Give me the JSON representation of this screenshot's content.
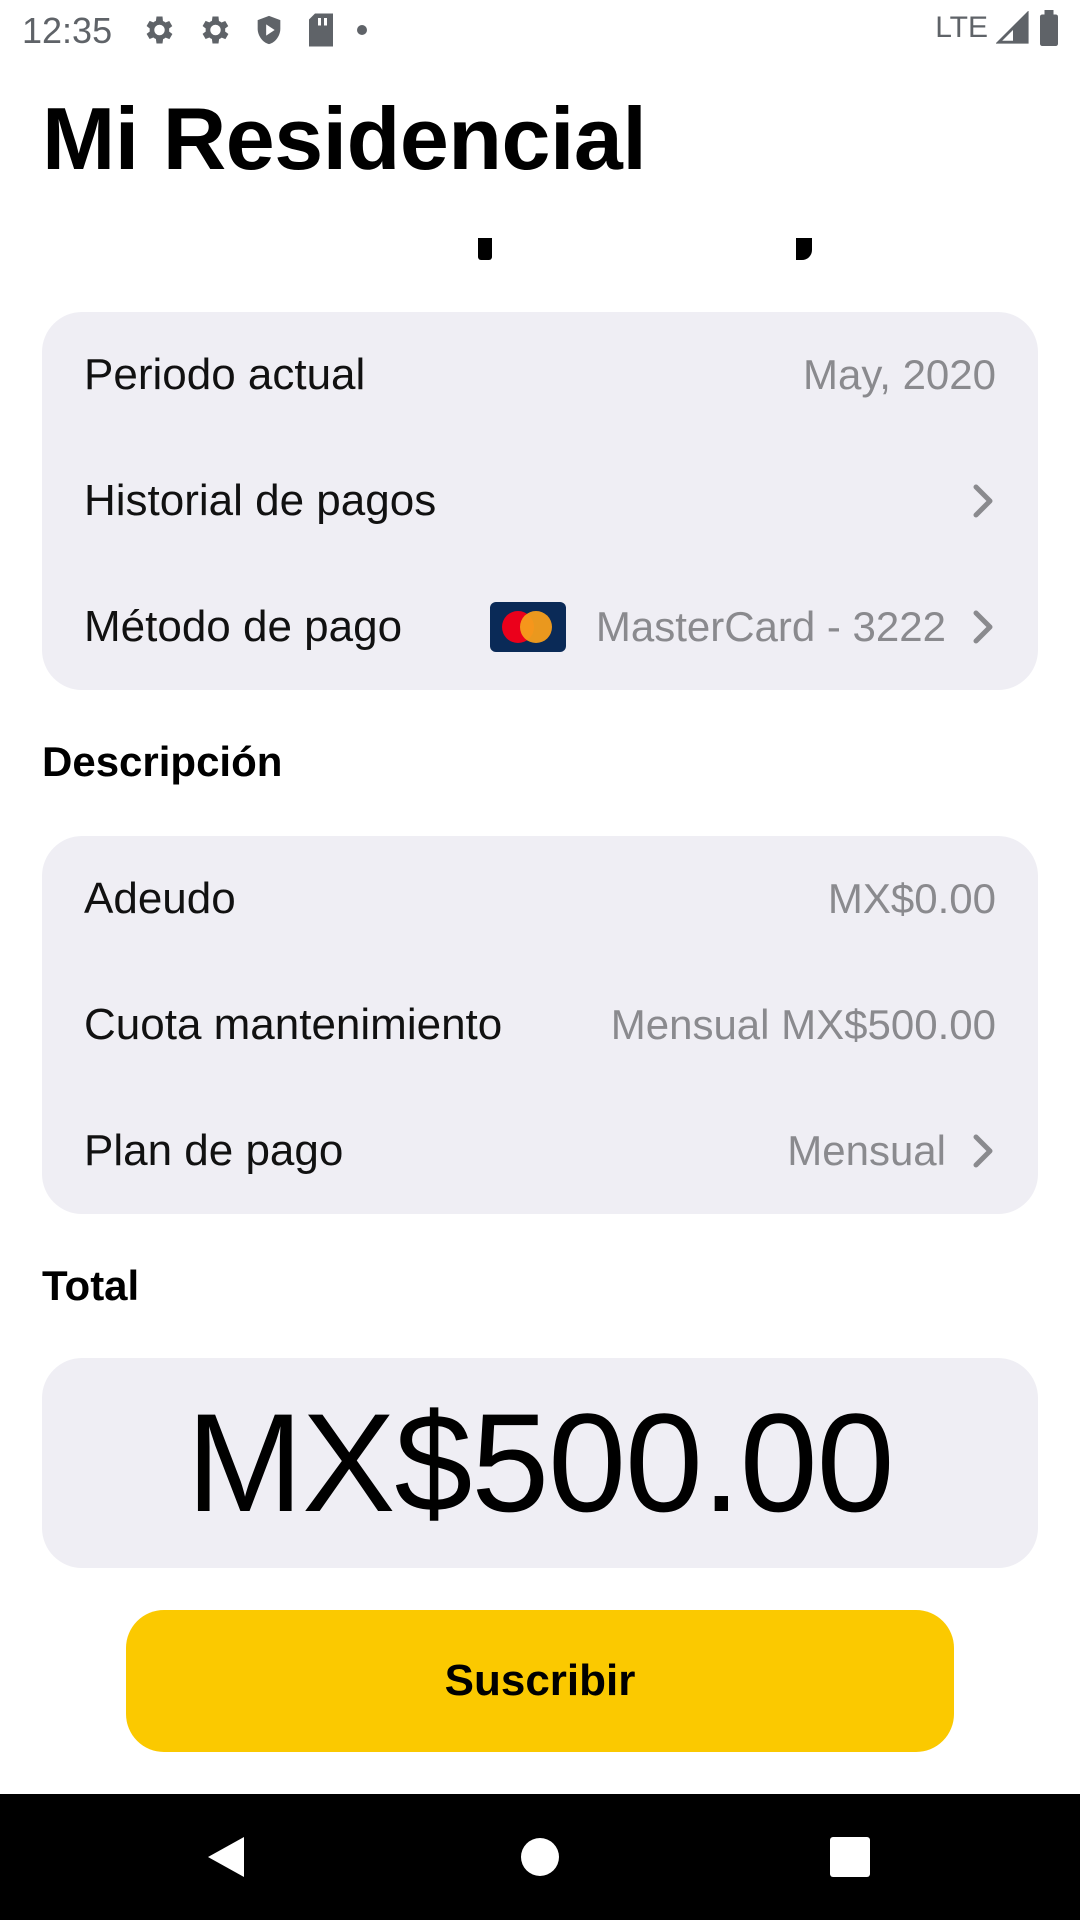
{
  "status_bar": {
    "time": "12:35",
    "network": "LTE",
    "icons": [
      "gear-icon",
      "gear-icon",
      "shield-play-icon",
      "sd-card-icon",
      "dot-icon",
      "signal-icon",
      "battery-icon"
    ]
  },
  "app": {
    "title": "Mi Residencial"
  },
  "period_card": {
    "rows": [
      {
        "label": "Periodo actual",
        "value": "May, 2020"
      },
      {
        "label": "Historial de pagos",
        "value": ""
      },
      {
        "label": "Método de pago",
        "value": "MasterCard - 3222",
        "card_brand": "mastercard-icon"
      }
    ]
  },
  "description": {
    "title": "Descripción",
    "rows": [
      {
        "label": "Adeudo",
        "value": "MX$0.00"
      },
      {
        "label": "Cuota mantenimiento",
        "value": "Mensual MX$500.00"
      },
      {
        "label": "Plan de pago",
        "value": "Mensual"
      }
    ]
  },
  "total": {
    "title": "Total",
    "amount": "MX$500.00"
  },
  "cta": {
    "label": "Suscribir",
    "color": "#fbc900"
  },
  "colors": {
    "card_bg": "#efeef4",
    "secondary_text": "#8a8a8e"
  }
}
